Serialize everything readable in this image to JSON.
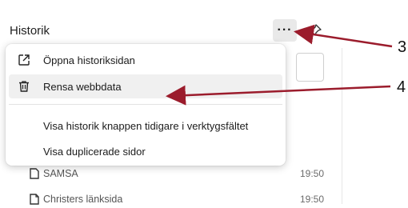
{
  "panel": {
    "title": "Historik",
    "more_icon": "more-horizontal-icon",
    "pin_icon": "pin-icon",
    "rows": [
      {
        "title": "SAMSA",
        "time": "19:50",
        "icon": "page-icon"
      },
      {
        "title": "Christers länksida",
        "time": "19:50",
        "icon": "page-icon"
      }
    ]
  },
  "menu": {
    "items": [
      {
        "label": "Öppna historiksidan",
        "icon": "open-external-icon"
      },
      {
        "label": "Rensa webbdata",
        "icon": "trash-icon"
      },
      {
        "label": "Visa historik knappen tidigare i verktygsfältet"
      },
      {
        "label": "Visa duplicerade sidor"
      }
    ]
  },
  "annotations": {
    "label_3": "3",
    "label_4": "4",
    "arrow_color": "#9b1c2c"
  }
}
